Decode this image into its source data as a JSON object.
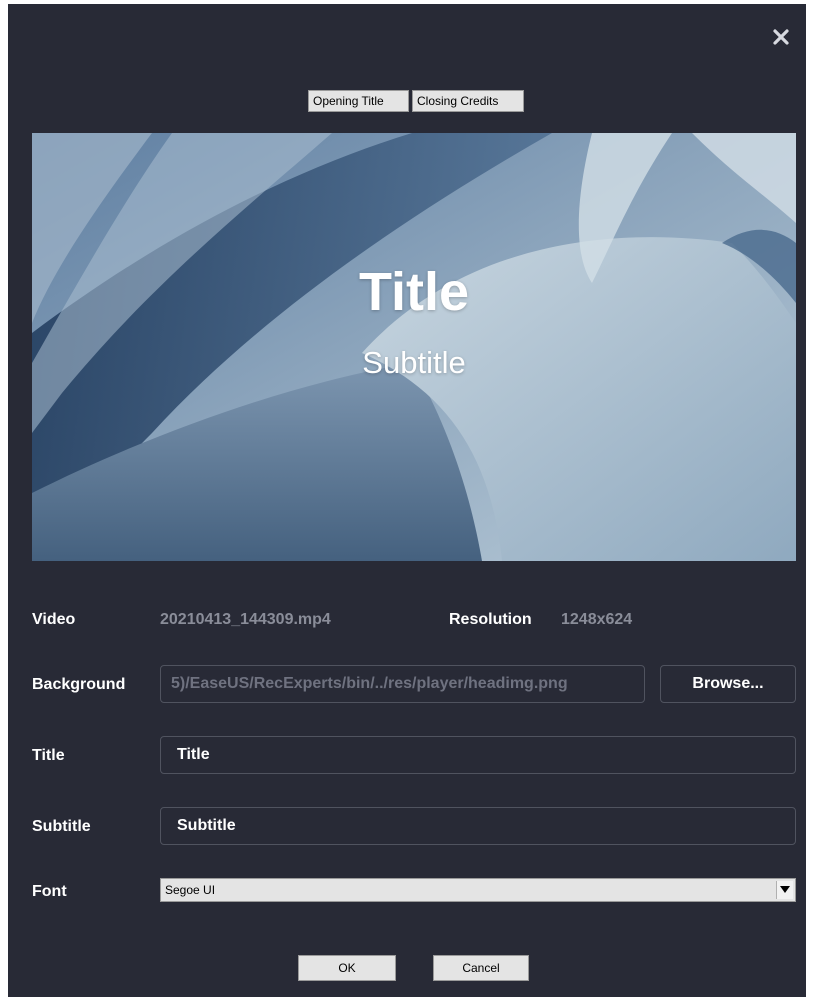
{
  "tabs": {
    "opening": "Opening Title",
    "closing": "Closing Credits"
  },
  "preview": {
    "title": "Title",
    "subtitle": "Subtitle"
  },
  "info": {
    "video_label": "Video",
    "video_value": "20210413_144309.mp4",
    "resolution_label": "Resolution",
    "resolution_value": "1248x624"
  },
  "form": {
    "background_label": "Background",
    "background_value": "5)/EaseUS/RecExperts/bin/../res/player/headimg.png",
    "browse_label": "Browse...",
    "title_label": "Title",
    "title_value": "Title",
    "subtitle_label": "Subtitle",
    "subtitle_value": "Subtitle",
    "font_label": "Font",
    "font_value": "Segoe UI"
  },
  "buttons": {
    "ok": "OK",
    "cancel": "Cancel"
  },
  "icons": {
    "close": "close-icon",
    "dropdown": "triangle-down-icon"
  },
  "colors": {
    "dialog_bg": "#282a36",
    "field_border": "#50535f",
    "muted_text": "#8a8d99",
    "button_bg": "#e4e4e4"
  }
}
